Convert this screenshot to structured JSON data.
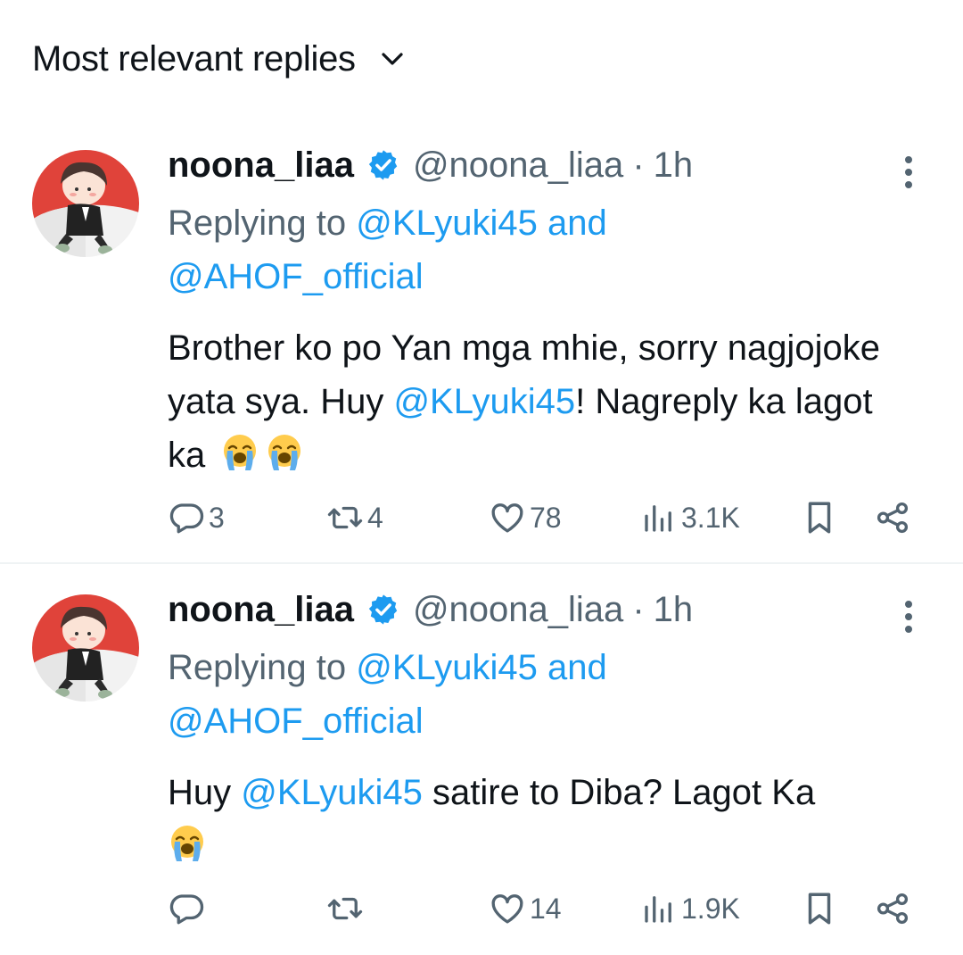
{
  "header": {
    "sort_label": "Most relevant replies",
    "chevron_icon": "chevron-down-icon"
  },
  "colors": {
    "link": "#1d9bf0",
    "secondary_text": "#536471",
    "primary_text": "#0f1419",
    "verified": "#1d9bf0"
  },
  "tweets": [
    {
      "display_name": "noona_liaa",
      "handle": "@noona_liaa",
      "separator": "·",
      "time": "1h",
      "replying_prefix": "Replying to",
      "replying_user_1": "@KLyuki45",
      "replying_joiner": "and",
      "replying_user_2": "@AHOF_official",
      "text_1": "Brother ko po Yan mga mhie, sorry nagjojoke yata sya. Huy ",
      "mention": "@KLyuki45",
      "text_2": "! Nagreply ka lagot ka",
      "emojis": [
        "loudly-crying-face",
        "loudly-crying-face"
      ],
      "replies": "3",
      "reposts": "4",
      "likes": "78",
      "views": "3.1K"
    },
    {
      "display_name": "noona_liaa",
      "handle": "@noona_liaa",
      "separator": "·",
      "time": "1h",
      "replying_prefix": "Replying to",
      "replying_user_1": "@KLyuki45",
      "replying_joiner": "and",
      "replying_user_2": "@AHOF_official",
      "text_1": "Huy ",
      "mention": "@KLyuki45",
      "text_2": " satire to Diba? Lagot Ka",
      "emojis": [
        "loudly-crying-face"
      ],
      "replies": "",
      "reposts": "",
      "likes": "14",
      "views": "1.9K"
    }
  ]
}
